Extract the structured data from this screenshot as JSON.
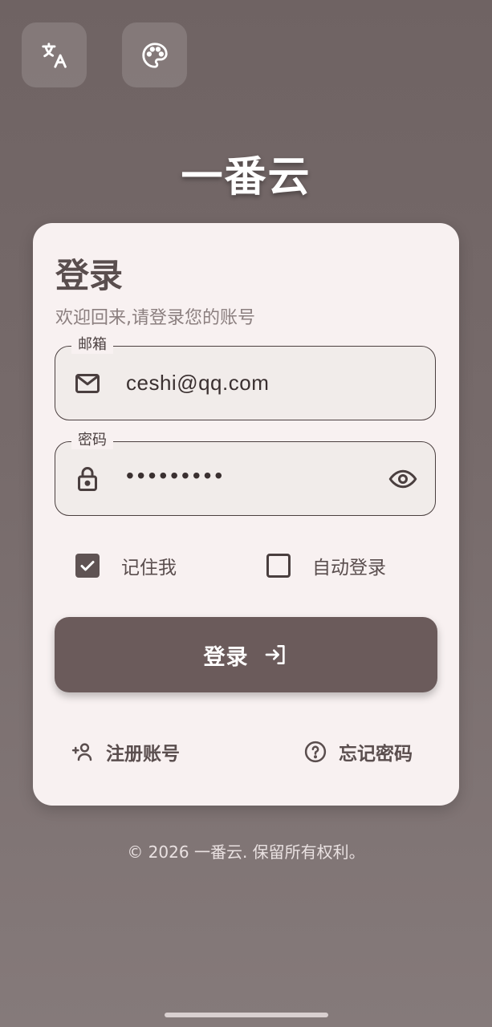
{
  "app": {
    "title": "一番云"
  },
  "top_buttons": [
    {
      "name": "translate",
      "icon": "translate-icon"
    },
    {
      "name": "theme",
      "icon": "palette-icon"
    }
  ],
  "login_card": {
    "title": "登录",
    "subtitle": "欢迎回来,请登录您的账号",
    "email": {
      "label": "邮箱",
      "value": "ceshi@qq.com",
      "icon": "mail-icon"
    },
    "password": {
      "label": "密码",
      "value": "•••••••••",
      "icon": "lock-icon",
      "toggle_icon": "eye-icon"
    },
    "remember_me": {
      "label": "记住我",
      "checked": true
    },
    "auto_login": {
      "label": "自动登录",
      "checked": false
    },
    "login_button": {
      "label": "登录",
      "icon": "login-arrow-icon"
    },
    "register_link": {
      "label": "注册账号",
      "icon": "add-user-icon"
    },
    "forgot_link": {
      "label": "忘记密码",
      "icon": "help-circle-icon"
    }
  },
  "footer": {
    "copyright": "© 2026 一番云. 保留所有权利。"
  },
  "colors": {
    "primary": "#6b5b5b",
    "card_bg": "#f8f1f1",
    "text": "#5a4e4e"
  }
}
